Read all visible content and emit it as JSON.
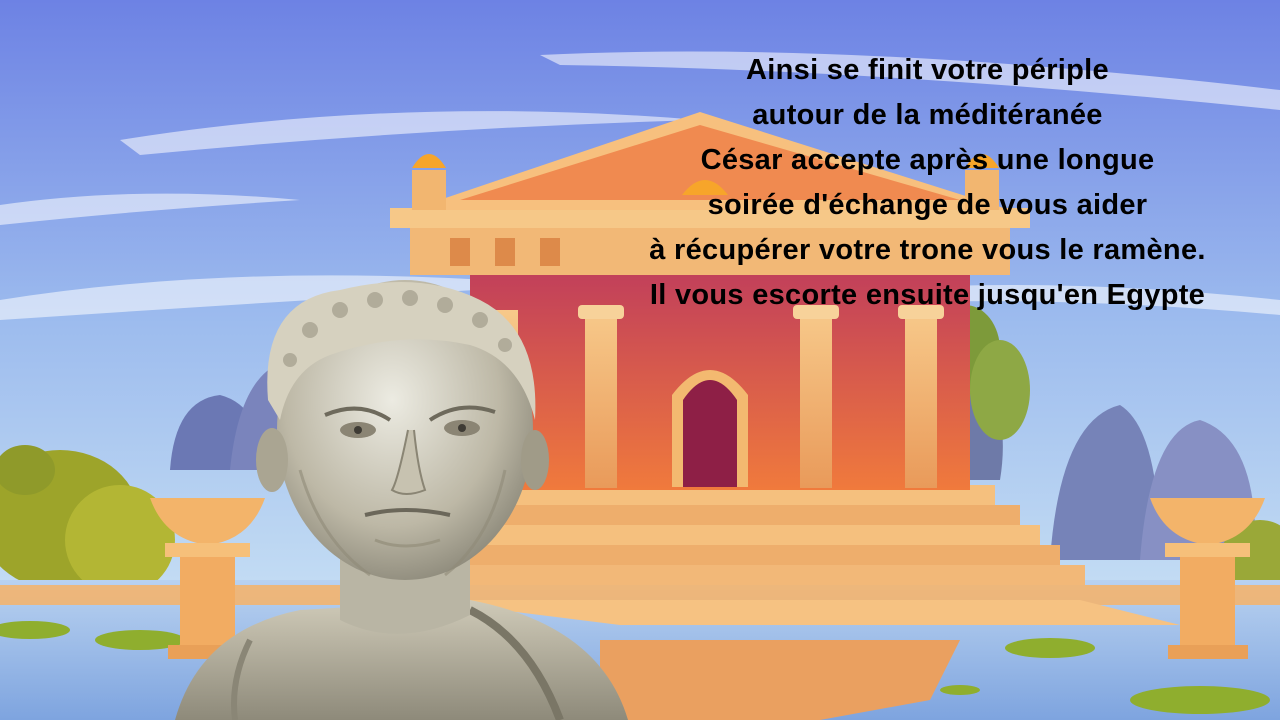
{
  "scene": {
    "setting": "temple-by-the-sea",
    "character": "caesar-bust"
  },
  "dialogue": {
    "lines": [
      "Ainsi se finit votre périple",
      "autour de la méditéranée",
      "César accepte après une longue",
      "soirée d'échange de vous aider",
      "à récupérer votre trone vous le ramène.",
      "Il vous escorte ensuite jusqu'en Egypte"
    ]
  },
  "colors": {
    "sky_top": "#6e86e6",
    "sky_bottom": "#c9e4f4",
    "temple_wall": "#e86a45",
    "temple_stone": "#f2b96e",
    "water": "#8fb7e8",
    "foliage": "#a8b12a",
    "marble": "#c9c4b4",
    "text": "#000000"
  }
}
